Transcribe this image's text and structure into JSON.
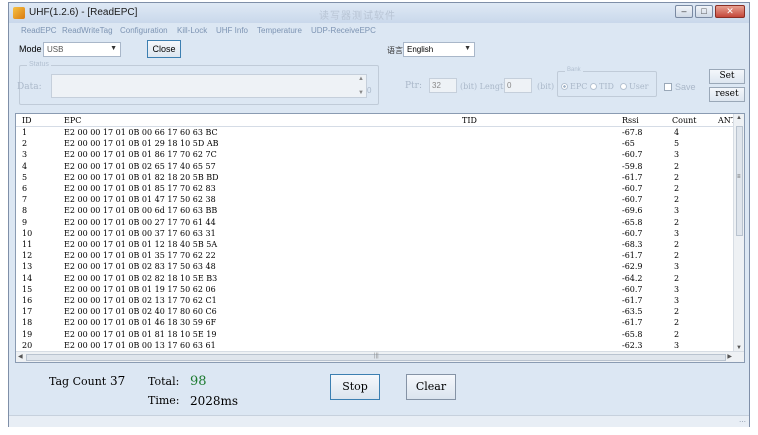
{
  "window": {
    "title": "UHF(1.2.6) - [ReadEPC]",
    "faded_title": "读写器测试软件",
    "buttons": {
      "minimize": "–",
      "maximize": "□",
      "close": "✕"
    }
  },
  "menu": {
    "items": [
      "ReadEPC",
      "ReadWriteTag",
      "Configuration",
      "Kill-Lock",
      "UHF Info",
      "Temperature",
      "UDP-ReceiveEPC"
    ]
  },
  "mode_bar": {
    "mode_label": "Mode",
    "mode_value": "USB",
    "close_button": "Close",
    "language_label": "语言",
    "language_value": "English"
  },
  "params": {
    "group_title": "Status",
    "data_label": "Data:",
    "data_suffix": "0",
    "ptr_label": "Ptr:",
    "ptr_value": "32",
    "ptr_unit": "(bit) Length:",
    "len_value": "0",
    "len_unit": "(bit)",
    "bank_title": "Bank",
    "bank_options": [
      "EPC",
      "TID",
      "User"
    ],
    "bank_selected": "EPC",
    "save_label": "Save",
    "set_button": "Set",
    "reset_button": "reset"
  },
  "table": {
    "columns": [
      "ID",
      "EPC",
      "TID",
      "Rssi",
      "Count",
      "ANT"
    ],
    "rows": [
      {
        "id": "1",
        "epc": "E2 00 00 17 01 0B 00 66 17 60 63 BC",
        "rssi": "-67.8",
        "count": "4"
      },
      {
        "id": "2",
        "epc": "E2 00 00 17 01 0B 01 29 18 10 5D AB",
        "rssi": "-65",
        "count": "5"
      },
      {
        "id": "3",
        "epc": "E2 00 00 17 01 0B 01 86 17 70 62 7C",
        "rssi": "-60.7",
        "count": "3"
      },
      {
        "id": "4",
        "epc": "E2 00 00 17 01 0B 02 65 17 40 65 57",
        "rssi": "-59.8",
        "count": "2"
      },
      {
        "id": "5",
        "epc": "E2 00 00 17 01 0B 01 82 18 20 5B BD",
        "rssi": "-61.7",
        "count": "2"
      },
      {
        "id": "6",
        "epc": "E2 00 00 17 01 0B 01 85 17 70 62 83",
        "rssi": "-60.7",
        "count": "2"
      },
      {
        "id": "7",
        "epc": "E2 00 00 17 01 0B 01 47 17 50 62 38",
        "rssi": "-60.7",
        "count": "2"
      },
      {
        "id": "8",
        "epc": "E2 00 00 17 01 0B 00 6d 17 60 63 BB",
        "rssi": "-69.6",
        "count": "3"
      },
      {
        "id": "9",
        "epc": "E2 00 00 17 01 0B 00 27 17 70 61 44",
        "rssi": "-65.8",
        "count": "2"
      },
      {
        "id": "10",
        "epc": "E2 00 00 17 01 0B 00 37 17 60 63 31",
        "rssi": "-60.7",
        "count": "3"
      },
      {
        "id": "11",
        "epc": "E2 00 00 17 01 0B 01 12 18 40 5B 5A",
        "rssi": "-68.3",
        "count": "2"
      },
      {
        "id": "12",
        "epc": "E2 00 00 17 01 0B 01 35 17 70 62 22",
        "rssi": "-61.7",
        "count": "2"
      },
      {
        "id": "13",
        "epc": "E2 00 00 17 01 0B 02 83 17 50 63 48",
        "rssi": "-62.9",
        "count": "3"
      },
      {
        "id": "14",
        "epc": "E2 00 00 17 01 0B 02 82 18 10 5E B3",
        "rssi": "-64.2",
        "count": "2"
      },
      {
        "id": "15",
        "epc": "E2 00 00 17 01 0B 01 19 17 50 62 06",
        "rssi": "-60.7",
        "count": "3"
      },
      {
        "id": "16",
        "epc": "E2 00 00 17 01 0B 02 13 17 70 62 C1",
        "rssi": "-61.7",
        "count": "3"
      },
      {
        "id": "17",
        "epc": "E2 00 00 17 01 0B 02 40 17 80 60 C6",
        "rssi": "-63.5",
        "count": "2"
      },
      {
        "id": "18",
        "epc": "E2 00 00 17 01 0B 01 46 18 30 59 6F",
        "rssi": "-61.7",
        "count": "2"
      },
      {
        "id": "19",
        "epc": "E2 00 00 17 01 0B 01 81 18 10 5E 19",
        "rssi": "-65.8",
        "count": "2"
      },
      {
        "id": "20",
        "epc": "E2 00 00 17 01 0B 00 13 17 60 63 61",
        "rssi": "-62.3",
        "count": "3"
      }
    ]
  },
  "stats": {
    "tag_count_label": "Tag Count",
    "tag_count_value": "37",
    "total_label": "Total:",
    "total_value": "98",
    "time_label": "Time:",
    "time_value": "2028ms"
  },
  "actions": {
    "stop": "Stop",
    "clear": "Clear"
  }
}
